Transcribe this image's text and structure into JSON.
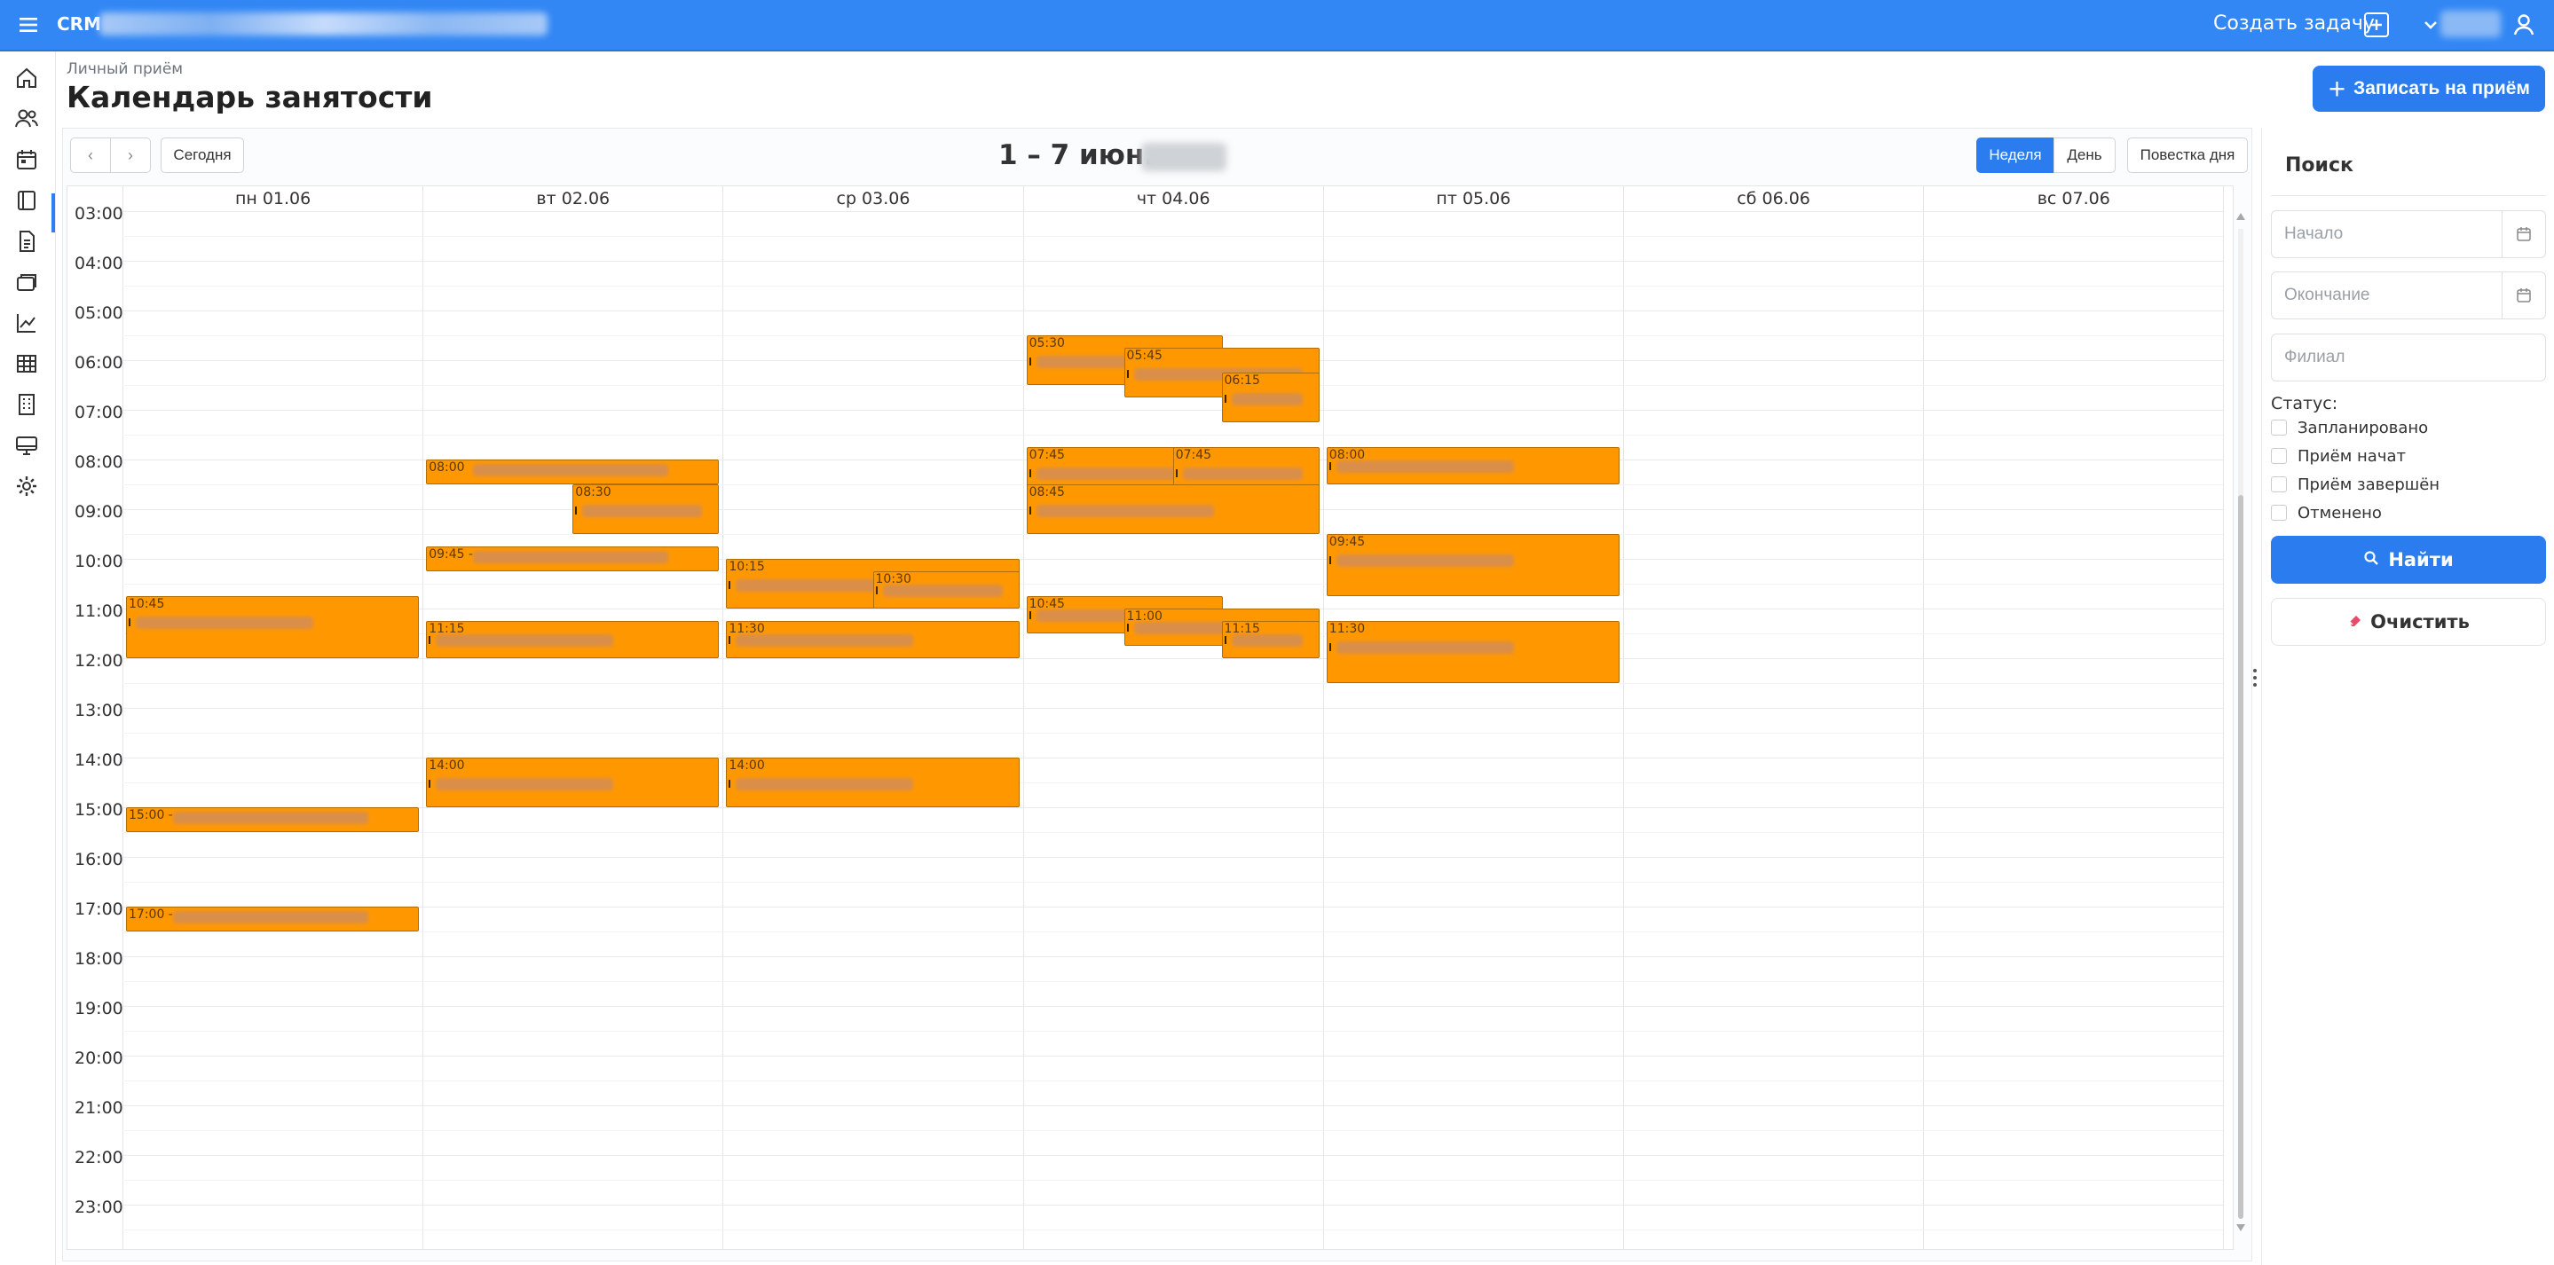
{
  "app": {
    "brand": "CRM",
    "create_task": "Создать задачу"
  },
  "header": {
    "breadcrumb": "Личный приём",
    "title": "Календарь занятости",
    "book_button": "Записать на приём"
  },
  "toolbar": {
    "today": "Сегодня",
    "range_title": "1 – 7 июн.",
    "views": {
      "week": "Неделя",
      "day": "День",
      "agenda": "Повестка дня"
    }
  },
  "days": [
    "пн 01.06",
    "вт 02.06",
    "ср 03.06",
    "чт 04.06",
    "пт 05.06",
    "сб 06.06",
    "вс 07.06"
  ],
  "hours": [
    "03:00",
    "04:00",
    "05:00",
    "06:00",
    "07:00",
    "08:00",
    "09:00",
    "10:00",
    "11:00",
    "12:00",
    "13:00",
    "14:00",
    "15:00",
    "16:00",
    "17:00",
    "18:00",
    "19:00",
    "20:00",
    "21:00",
    "22:00",
    "23:00"
  ],
  "events": [
    {
      "day": 0,
      "start": "10:45",
      "end": "12:00",
      "label": "10:45",
      "lane": 0,
      "lanes": 1
    },
    {
      "day": 0,
      "start": "15:00",
      "end": "15:30",
      "label": "15:00 -",
      "lane": 0,
      "lanes": 1
    },
    {
      "day": 0,
      "start": "17:00",
      "end": "17:30",
      "label": "17:00 -",
      "lane": 0,
      "lanes": 1
    },
    {
      "day": 1,
      "start": "08:00",
      "end": "08:30",
      "label": "08:00",
      "lane": 0,
      "lanes": 1
    },
    {
      "day": 1,
      "start": "08:30",
      "end": "09:30",
      "label": "08:30",
      "lane": 1,
      "lanes": 2
    },
    {
      "day": 1,
      "start": "09:45",
      "end": "10:15",
      "label": "09:45 -",
      "lane": 0,
      "lanes": 1
    },
    {
      "day": 1,
      "start": "11:15",
      "end": "12:00",
      "label": "11:15",
      "lane": 0,
      "lanes": 1
    },
    {
      "day": 1,
      "start": "14:00",
      "end": "15:00",
      "label": "14:00",
      "lane": 0,
      "lanes": 1
    },
    {
      "day": 2,
      "start": "10:00",
      "end": "11:00",
      "label": "10:15",
      "lane": 0,
      "lanes": 1
    },
    {
      "day": 2,
      "start": "10:15",
      "end": "11:00",
      "label": "10:30",
      "lane": 1,
      "lanes": 2
    },
    {
      "day": 2,
      "start": "11:15",
      "end": "12:00",
      "label": "11:30",
      "lane": 0,
      "lanes": 1
    },
    {
      "day": 2,
      "start": "14:00",
      "end": "15:00",
      "label": "14:00",
      "lane": 0,
      "lanes": 1
    },
    {
      "day": 3,
      "start": "05:30",
      "end": "06:30",
      "label": "05:30",
      "lane": 0,
      "lanes": 2
    },
    {
      "day": 3,
      "start": "05:45",
      "end": "06:45",
      "label": "05:45",
      "lane": 1,
      "lanes": 3
    },
    {
      "day": 3,
      "start": "06:15",
      "end": "07:15",
      "label": "06:15",
      "lane": 2,
      "lanes": 3
    },
    {
      "day": 3,
      "start": "07:45",
      "end": "08:45",
      "label": "07:45",
      "lane": 0,
      "lanes": 2
    },
    {
      "day": 3,
      "start": "07:45",
      "end": "08:45",
      "label": "07:45",
      "lane": 1,
      "lanes": 2
    },
    {
      "day": 3,
      "start": "08:30",
      "end": "09:30",
      "label": "08:45",
      "lane": 0,
      "lanes": 1
    },
    {
      "day": 3,
      "start": "10:45",
      "end": "11:30",
      "label": "10:45",
      "lane": 0,
      "lanes": 2
    },
    {
      "day": 3,
      "start": "11:00",
      "end": "11:45",
      "label": "11:00",
      "lane": 1,
      "lanes": 3
    },
    {
      "day": 3,
      "start": "11:15",
      "end": "12:00",
      "label": "11:15",
      "lane": 2,
      "lanes": 3
    },
    {
      "day": 4,
      "start": "07:45",
      "end": "08:30",
      "label": "08:00",
      "lane": 0,
      "lanes": 1
    },
    {
      "day": 4,
      "start": "09:30",
      "end": "10:45",
      "label": "09:45",
      "lane": 0,
      "lanes": 1
    },
    {
      "day": 4,
      "start": "11:15",
      "end": "12:30",
      "label": "11:30",
      "lane": 0,
      "lanes": 1
    }
  ],
  "search": {
    "title": "Поиск",
    "start_placeholder": "Начало",
    "end_placeholder": "Окончание",
    "branch_placeholder": "Филиал",
    "status_label": "Статус:",
    "statuses": [
      "Запланировано",
      "Приём начат",
      "Приём завершён",
      "Отменено"
    ],
    "find": "Найти",
    "clear": "Очистить"
  }
}
